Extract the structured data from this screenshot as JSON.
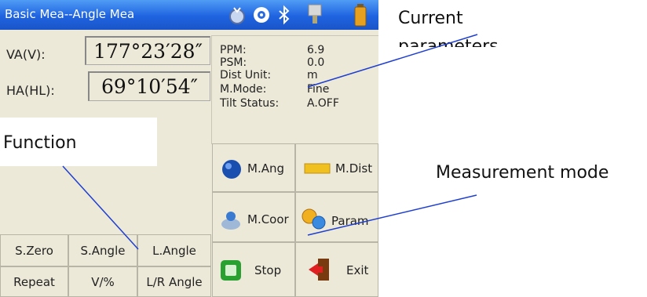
{
  "window": {
    "title": "Basic Mea--Angle Mea"
  },
  "status_icons": [
    "satellite-icon",
    "settings-icon",
    "bluetooth-icon",
    "plug-icon",
    "battery-icon"
  ],
  "readings": {
    "va_label": "VA(V):",
    "va_value": "177°23′28″",
    "ha_label": "HA(HL):",
    "ha_value": "69°10′54″"
  },
  "parameters": [
    {
      "label": "PPM:",
      "value": "6.9"
    },
    {
      "label": "PSM:",
      "value": "0.0"
    },
    {
      "label": "Dist Unit:",
      "value": "m"
    },
    {
      "label": "M.Mode:",
      "value": "Fine"
    },
    {
      "label": "Tilt Status:",
      "value": "A.OFF"
    }
  ],
  "mode_buttons": {
    "m_ang": "M.Ang",
    "m_dist": "M.Dist",
    "m_coor": "M.Coor",
    "param": "Param",
    "stop": "Stop",
    "exit": "Exit"
  },
  "function_buttons": {
    "s_zero": "S.Zero",
    "s_angle": "S.Angle",
    "l_angle": "L.Angle",
    "repeat": "Repeat",
    "v_percent": "V/%",
    "lr_angle": "L/R Angle"
  },
  "annotations": {
    "current_params": "Current parameters",
    "function": "Function",
    "measurement_mode": "Measurement mode"
  },
  "colors": {
    "titlebar": "#1f63e0",
    "annotation_line": "#1f3fd0",
    "panel_bg": "#ece9d8"
  }
}
